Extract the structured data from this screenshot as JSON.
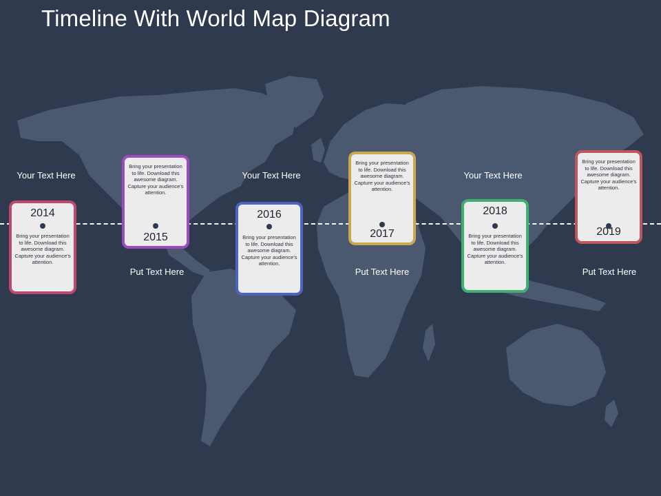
{
  "title": "Timeline With World Map Diagram",
  "colors": {
    "background": "#2f3a4f",
    "map": "#4a5970",
    "timeline": "#ffffff"
  },
  "cards": [
    {
      "year": "2014",
      "text": "Bring your presentation to life. Download this awesome diagram. Capture your audience's attention.",
      "border": "#c0476d"
    },
    {
      "year": "2015",
      "text": "Bring your presentation to life. Download this awesome diagram. Capture your audience's attention.",
      "border": "#9a4cc0"
    },
    {
      "year": "2016",
      "text": "Bring your presentation to life. Download this awesome diagram. Capture your audience's attention.",
      "border": "#4d63c0"
    },
    {
      "year": "2017",
      "text": "Bring your presentation to life. Download this awesome diagram. Capture your audience's attention.",
      "border": "#c9a852"
    },
    {
      "year": "2018",
      "text": "Bring your presentation to life. Download this awesome diagram. Capture your audience's attention.",
      "border": "#3fb071"
    },
    {
      "year": "2019",
      "text": "Bring your presentation to life. Download this awesome diagram. Capture your audience's attention.",
      "border": "#c0555d"
    }
  ],
  "labels_top": [
    "Your Text Here",
    "Your Text Here",
    "Your Text Here"
  ],
  "labels_bottom": [
    "Put Text Here",
    "Put Text Here",
    "Put Text Here"
  ]
}
